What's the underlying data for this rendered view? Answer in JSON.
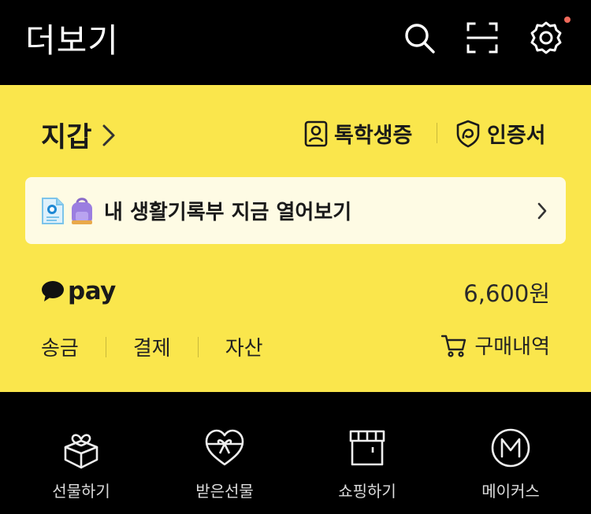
{
  "header": {
    "title": "더보기",
    "icons": [
      "search-icon",
      "scan-icon",
      "gear-icon"
    ],
    "notification_dot_color": "#f06a5b"
  },
  "wallet": {
    "title": "지갑",
    "background_color": "#fae64c",
    "quick_links": [
      {
        "label": "톡학생증",
        "icon": "student-id-icon"
      },
      {
        "label": "인증서",
        "icon": "certificate-shield-icon"
      }
    ],
    "banner": {
      "text": "내 생활기록부 지금 열어보기",
      "icons": [
        "document-icon",
        "backpack-icon"
      ]
    },
    "pay": {
      "logo_text": "pay",
      "balance": "6,600원",
      "actions": [
        "송금",
        "결제",
        "자산"
      ],
      "purchase_label": "구매내역"
    }
  },
  "bottom_tabs": [
    {
      "label": "선물하기",
      "icon": "gift-box-icon"
    },
    {
      "label": "받은선물",
      "icon": "heart-gift-icon"
    },
    {
      "label": "쇼핑하기",
      "icon": "store-icon"
    },
    {
      "label": "메이커스",
      "icon": "makers-m-icon"
    }
  ]
}
